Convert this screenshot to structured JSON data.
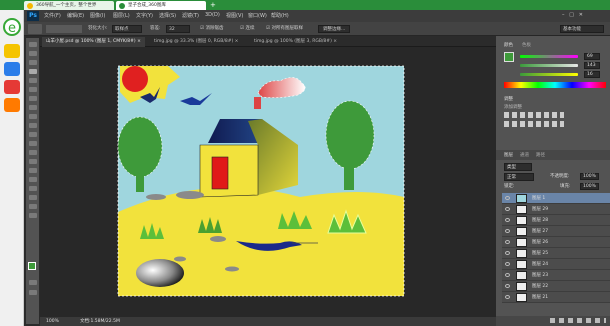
{
  "browser": {
    "tabs": [
      {
        "label": "360导航_一个主页，整个世界"
      },
      {
        "label": "皇子合成_360图库"
      }
    ],
    "new_tab": "+"
  },
  "ps": {
    "logo": "Ps",
    "menu": [
      "文件(F)",
      "编辑(E)",
      "图像(I)",
      "图层(L)",
      "文字(Y)",
      "选择(S)",
      "滤镜(T)",
      "3D(D)",
      "视图(V)",
      "窗口(W)",
      "帮助(H)"
    ],
    "options": {
      "feather_label": "羽化大小:",
      "feather_value": "取样点",
      "tolerance_label": "容差:",
      "tolerance_value": "32",
      "anti_alias": "消除锯齿",
      "contiguous": "连续",
      "sample_all": "对所有图层取样",
      "refine_edge": "调整边缘...",
      "workspace": "基本功能"
    },
    "doc_tabs": [
      {
        "label": "山羊小屋.psd @ 100% (图层 1, CMYK/8#) ×"
      },
      {
        "label": "timg.jpg @ 33.3% (图层 0, RGB/8#) ×"
      },
      {
        "label": "timg.jpg @ 100% (图层 3, RGB/8#) ×"
      }
    ],
    "status": {
      "zoom": "100%",
      "doc": "文档:1.58M/22.5M"
    },
    "color_panel": {
      "title": "颜色",
      "tab2": "色板",
      "c_value": "69",
      "m_value": "143",
      "y_value": "16"
    },
    "adjust_panel": {
      "title": "调整",
      "subtitle": "添加调整"
    },
    "layers_panel": {
      "title": "图层",
      "tab2": "通道",
      "tab3": "路径",
      "kind": "类型",
      "mode": "正常",
      "opacity_label": "不透明度:",
      "opacity": "100%",
      "lock_label": "锁定:",
      "fill_label": "填充:",
      "fill": "100%",
      "layers": [
        "图层 1",
        "图层 29",
        "图层 28",
        "图层 27",
        "图层 26",
        "图层 25",
        "图层 24",
        "图层 23",
        "图层 22",
        "图层 21"
      ]
    }
  },
  "colors": {
    "browser_green": "#2a8d3a",
    "ps_blue": "#31a8ff",
    "sky": "#9fd6de",
    "ground": "#f2e23c",
    "house_wall": "#c9bd24",
    "roof": "#1a3a8a",
    "door": "#e01818",
    "tree": "#3e9a3a",
    "sun": "#e02020"
  }
}
